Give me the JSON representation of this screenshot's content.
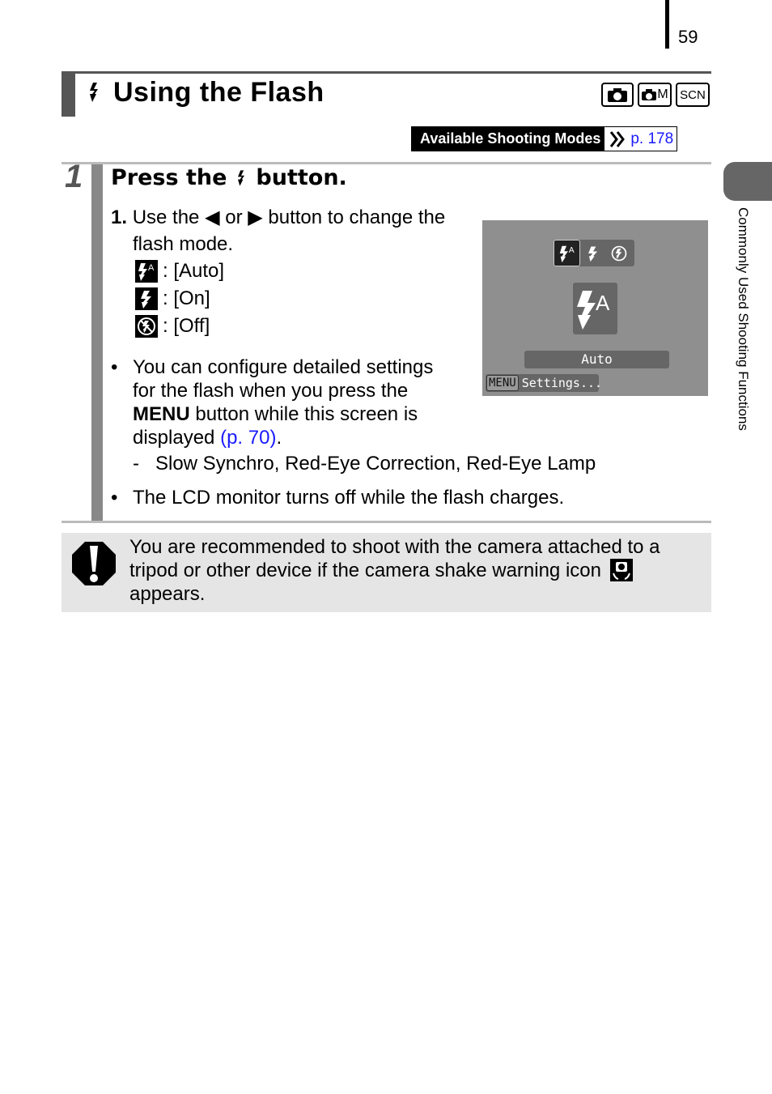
{
  "page_number": "59",
  "title": {
    "text": "Using the Flash",
    "icon": "flash-icon"
  },
  "mode_icons": [
    {
      "name": "auto-mode-icon",
      "label": ""
    },
    {
      "name": "manual-mode-icon",
      "label": "M"
    },
    {
      "name": "scene-mode-icon",
      "label": "SCN"
    }
  ],
  "available_modes": {
    "label": "Available Shooting Modes",
    "link": "p. 178",
    "icon": "double-chevron-right-icon"
  },
  "step": {
    "number": "1",
    "heading_prefix": "Press the",
    "heading_suffix": "button.",
    "instruction": {
      "number": "1.",
      "text_a": "Use the",
      "left_arrow": "◀",
      "or": "or",
      "right_arrow": "▶",
      "text_b": "button to change the",
      "text_c": "flash mode."
    },
    "modes": [
      {
        "icon": "flash-auto-icon",
        "label": ": [Auto]"
      },
      {
        "icon": "flash-on-icon",
        "label": ": [On]"
      },
      {
        "icon": "flash-off-icon",
        "label": ": [Off]"
      }
    ],
    "bullets": [
      {
        "lines": [
          "You can configure detailed settings",
          "for the flash when you press the"
        ],
        "bold": "MENU",
        "after_bold": " button while this screen is",
        "last_prefix": "displayed ",
        "link": "(p. 70)",
        "last_suffix": ".",
        "sub": "-   Slow Synchro, Red-Eye Correction, Red-Eye Lamp"
      },
      {
        "text": "The LCD monitor turns off while the flash charges."
      }
    ],
    "bullet_char": "•"
  },
  "lcd_screen": {
    "selected_mode_label": "Auto",
    "menu_button": "MENU",
    "menu_text": "Settings..."
  },
  "caution": {
    "lines": [
      "You are recommended to shoot with the camera attached to a",
      "tripod or other device if the camera shake warning icon",
      "appears."
    ]
  },
  "side_tab": {
    "label": "Commonly Used Shooting Functions"
  }
}
